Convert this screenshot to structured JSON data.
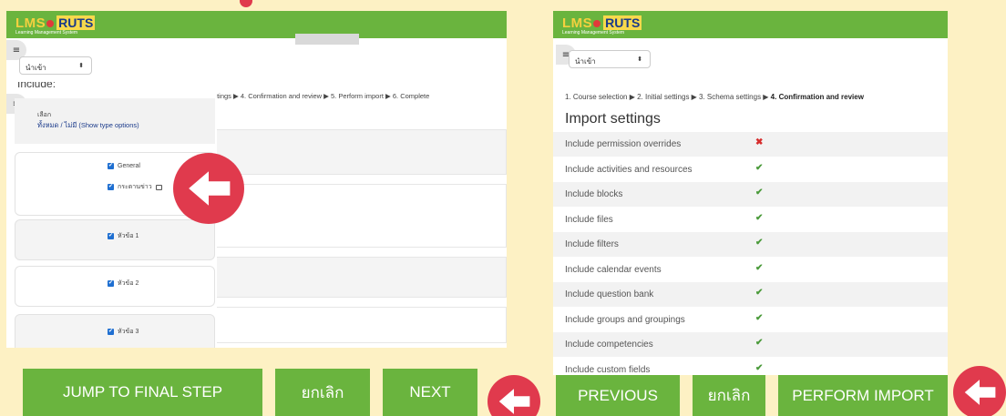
{
  "left_panel": {
    "logo_main": "LMS",
    "logo_brand": "RUTS",
    "logo_sub": "Learning Management System",
    "nav_select": "นำเข้า",
    "include_heading": "Include:",
    "breadcrumb_partial": "ttings ▶ 4. Confirmation and review ▶ 5. Perform import ▶ 6. Complete",
    "select_label": "เลือก",
    "select_links": "ทั้งหมด / ไม่มี (Show type options)",
    "sections": [
      {
        "label": "General",
        "checked": true
      },
      {
        "label": "กระดานข่าว",
        "checked": true
      },
      {
        "label": "หัวข้อ 1",
        "checked": true
      },
      {
        "label": "หัวข้อ 2",
        "checked": true
      },
      {
        "label": "หัวข้อ 3",
        "checked": true
      }
    ]
  },
  "right_panel": {
    "logo_main": "LMS",
    "logo_brand": "RUTS",
    "logo_sub": "Learning Management System",
    "nav_select": "นำเข้า",
    "breadcrumb": {
      "before": "1. Course selection ▶ 2. Initial settings ▶ 3. Schema settings ▶ ",
      "current": "4. Confirmation and review"
    },
    "heading": "Import settings",
    "settings": [
      {
        "label": "Include permission overrides",
        "value": false
      },
      {
        "label": "Include activities and resources",
        "value": true
      },
      {
        "label": "Include blocks",
        "value": true
      },
      {
        "label": "Include files",
        "value": true
      },
      {
        "label": "Include filters",
        "value": true
      },
      {
        "label": "Include calendar events",
        "value": true
      },
      {
        "label": "Include question bank",
        "value": true
      },
      {
        "label": "Include groups and groupings",
        "value": true
      },
      {
        "label": "Include competencies",
        "value": true
      },
      {
        "label": "Include custom fields",
        "value": true
      }
    ]
  },
  "buttons": {
    "jump": "JUMP TO FINAL STEP",
    "cancel_left": "ยกเลิก",
    "next": "NEXT",
    "previous": "PREVIOUS",
    "cancel_right": "ยกเลิก",
    "perform": "PERFORM IMPORT"
  },
  "colors": {
    "background": "#fdf1c4",
    "brand_green": "#6ab43e",
    "arrow_red": "#e03a4d",
    "check_green": "#4a9a3a",
    "cross_red": "#d62d2d",
    "checkbox_blue": "#1f6fd1"
  },
  "icons": {
    "check": "✔",
    "cross": "✖",
    "drawer": "≡",
    "chevron": "⬍"
  }
}
